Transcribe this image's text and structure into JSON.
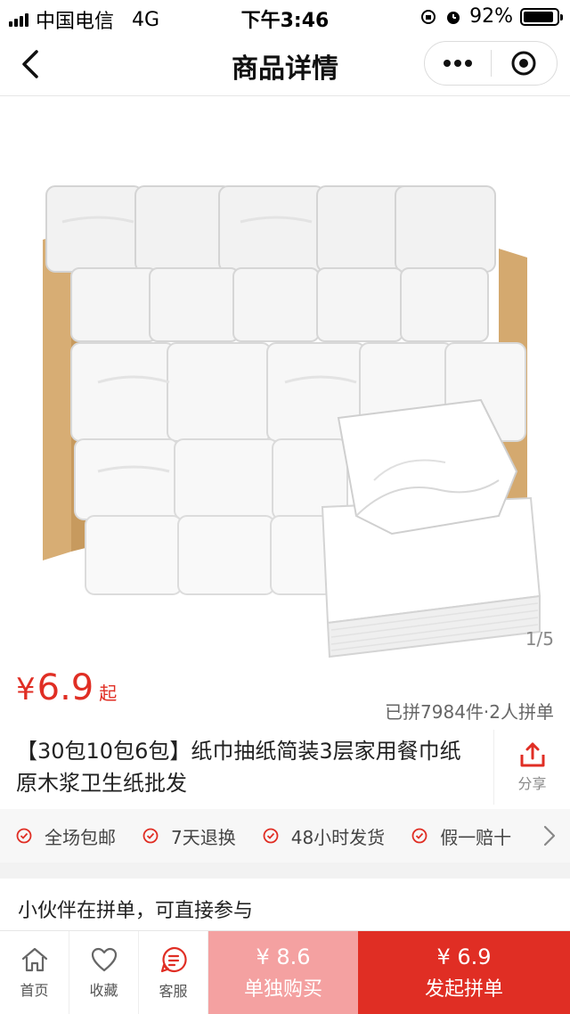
{
  "status_bar": {
    "carrier": "中国电信",
    "network": "4G",
    "time": "下午3:46",
    "battery": "92%",
    "battery_level": 0.92
  },
  "nav": {
    "title": "商品详情",
    "icons": [
      "back-icon",
      "more-icon",
      "close-target-icon"
    ]
  },
  "gallery": {
    "page_indicator": "1/5"
  },
  "price": {
    "currency": "¥",
    "amount": "6.9",
    "suffix": "起"
  },
  "sold_info": "已拼7984件·2人拼单",
  "product_title": "【30包10包6包】纸巾抽纸简装3层家用餐巾纸原木浆卫生纸批发",
  "share": {
    "label": "分享",
    "icon": "share-icon"
  },
  "guarantees": [
    "全场包邮",
    "7天退换",
    "48小时发货",
    "假一赔十"
  ],
  "group_section": {
    "label": "小伙伴在拼单，可直接参与"
  },
  "bottom_bar": {
    "tabs": [
      {
        "label": "首页",
        "icon": "home-icon"
      },
      {
        "label": "收藏",
        "icon": "heart-icon"
      },
      {
        "label": "客服",
        "icon": "chat-icon"
      }
    ],
    "buy_alone": {
      "price": "¥ 8.6",
      "label": "单独购买"
    },
    "buy_group": {
      "price": "¥ 6.9",
      "label": "发起拼单"
    }
  },
  "colors": {
    "accent": "#e02e24",
    "buy_alone_bg": "#f4a1a1"
  }
}
